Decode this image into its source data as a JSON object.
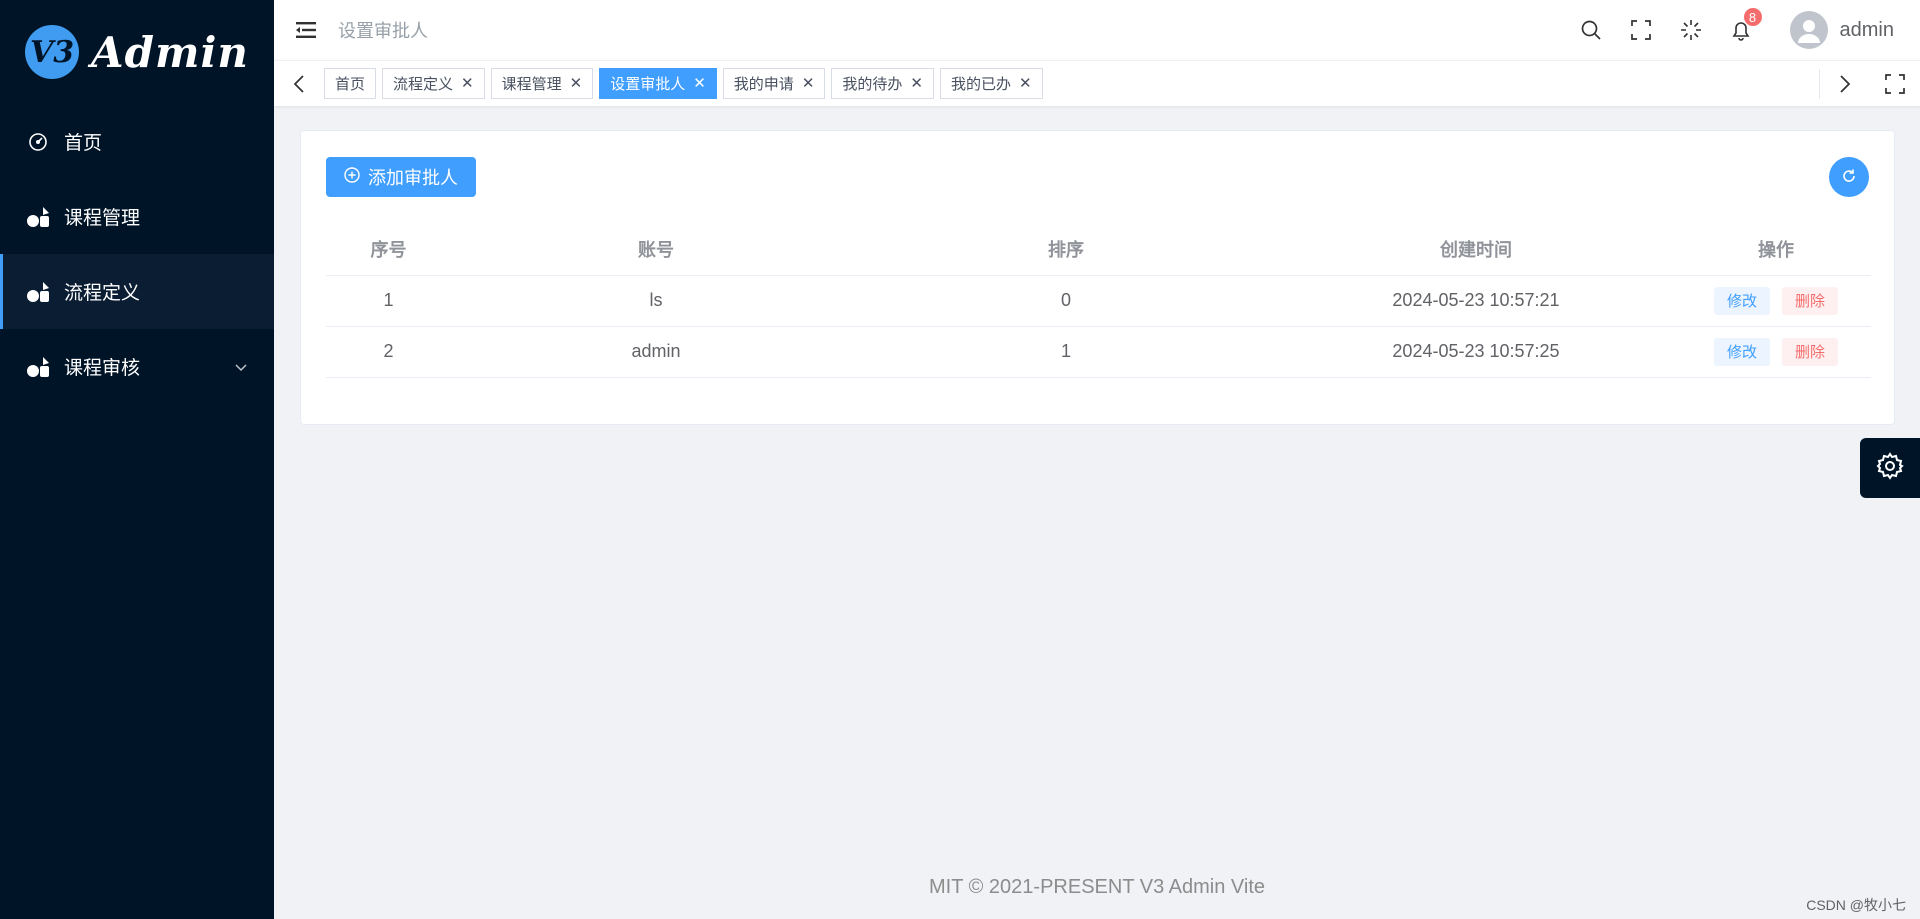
{
  "app": {
    "logo_badge": "V3",
    "logo_text": "Admin"
  },
  "sidebar": {
    "items": [
      {
        "label": "首页",
        "icon": "dashboard-icon",
        "active": false
      },
      {
        "label": "课程管理",
        "icon": "shapes-icon",
        "active": false
      },
      {
        "label": "流程定义",
        "icon": "shapes-icon",
        "active": true
      },
      {
        "label": "课程审核",
        "icon": "shapes-icon",
        "active": false,
        "has_children": true
      }
    ]
  },
  "header": {
    "breadcrumb": "设置审批人",
    "notification_count": "8",
    "username": "admin"
  },
  "tags": [
    {
      "label": "首页",
      "closable": false,
      "active": false
    },
    {
      "label": "流程定义",
      "closable": true,
      "active": false
    },
    {
      "label": "课程管理",
      "closable": true,
      "active": false
    },
    {
      "label": "设置审批人",
      "closable": true,
      "active": true
    },
    {
      "label": "我的申请",
      "closable": true,
      "active": false
    },
    {
      "label": "我的待办",
      "closable": true,
      "active": false
    },
    {
      "label": "我的已办",
      "closable": true,
      "active": false
    }
  ],
  "toolbar": {
    "add_label": "添加审批人"
  },
  "table": {
    "columns": [
      "序号",
      "账号",
      "排序",
      "创建时间",
      "操作"
    ],
    "rows": [
      {
        "index": "1",
        "account": "ls",
        "sort": "0",
        "created": "2024-05-23 10:57:21"
      },
      {
        "index": "2",
        "account": "admin",
        "sort": "1",
        "created": "2024-05-23 10:57:25"
      }
    ],
    "edit_label": "修改",
    "delete_label": "删除"
  },
  "footer": {
    "text": "MIT © 2021-PRESENT V3 Admin Vite"
  },
  "watermark": "CSDN @牧小七",
  "colors": {
    "primary": "#409eff",
    "sidebar_bg": "#001428",
    "danger": "#f56c6c"
  }
}
